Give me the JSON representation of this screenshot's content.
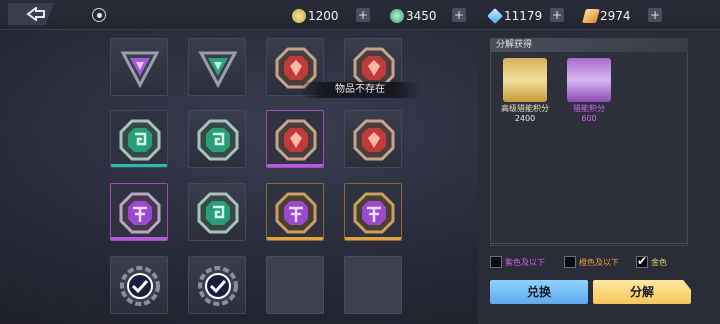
{
  "currencies": [
    {
      "icon": "gold-coin-icon",
      "value": "1200",
      "color": "#d8c46a"
    },
    {
      "icon": "green-coin-icon",
      "value": "3450",
      "color": "#6fd39a"
    },
    {
      "icon": "diamond-icon",
      "value": "11179",
      "color": "#8fd6ff"
    },
    {
      "icon": "ticket-icon",
      "value": "2974",
      "color": "#f0b84a"
    }
  ],
  "grid": {
    "rows": [
      [
        "grey-purple-triangle",
        "grey-green-triangle",
        "grey-red-octagon",
        "grey-red-octagon"
      ],
      [
        "rare-green-octagon",
        "grey-green-octagon",
        "epic-red-octagon",
        "grey-red-octagon"
      ],
      [
        "epic-purple-octagon",
        "grey-green-octagon",
        "legend-purple-octagon",
        "legend-purple-octagon"
      ],
      [
        "grey-checked-gear",
        "grey-checked-gear",
        "empty",
        "empty"
      ]
    ]
  },
  "tooltip": "物品不存在",
  "panel": {
    "title": "分解获得",
    "rewards": [
      {
        "name": "高级猎能积分",
        "qty": "2400",
        "tone": "gold"
      },
      {
        "name": "猎能积分",
        "qty": "600",
        "tone": "purple"
      }
    ]
  },
  "filters": [
    {
      "label": "紫色及以下",
      "checked": false
    },
    {
      "label": "橙色及以下",
      "checked": false
    },
    {
      "label": "金色",
      "checked": true
    }
  ],
  "buttons": {
    "exchange": "兑换",
    "decompose": "分解"
  }
}
